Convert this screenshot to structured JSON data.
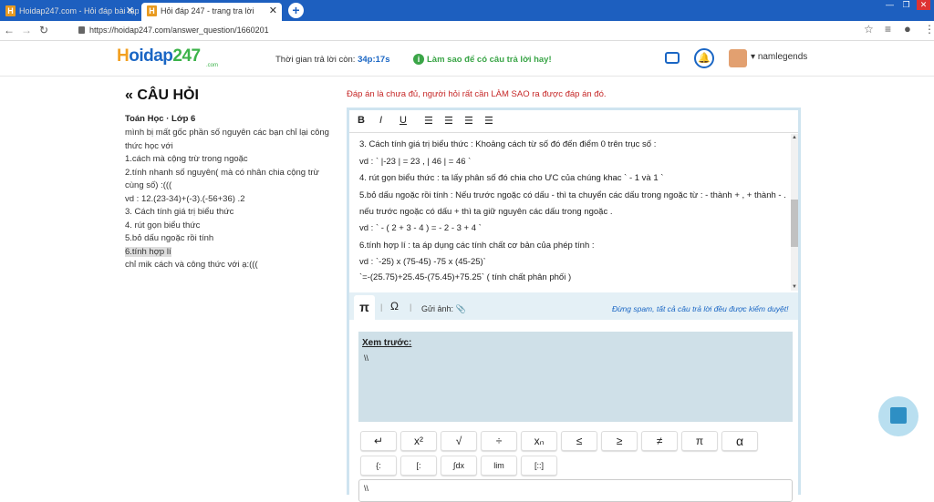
{
  "browser": {
    "tabs": [
      {
        "title": "Hoidap247.com - Hỏi đáp bài tập",
        "favicon": "H"
      },
      {
        "title": "Hỏi đáp 247 - trang tra lời",
        "favicon": "H"
      }
    ],
    "url": "https://hoidap247.com/answer_question/1660201",
    "new_tab": "+"
  },
  "header": {
    "logo": {
      "h": "H",
      "oi": "oidap",
      "num": "247",
      "sub": ".com"
    },
    "timer_label": "Thời gian trả lời còn:",
    "timer_value": "34p:17s",
    "howto": "Làm sao để có câu trả lời hay!",
    "username": "namlegends",
    "info_icon": "i"
  },
  "question": {
    "heading": "« CÂU HỎI",
    "meta": "Toán Học · Lớp 6",
    "lines": [
      "mình bị mất gốc phần số nguyên các bạn chỉ lại công thức học với",
      "1.cách mà cộng trừ trong ngoặc",
      "2.tính nhanh số nguyên( mà có nhân chia cộng trừ cùng số) :(((",
      "vd : 12.(23-34)+(-3).(-56+36) .2",
      "3. Cách tính giá trị biểu thức",
      "4. rút gọn biểu thức",
      "5.bỏ dấu ngoặc rồi tính",
      "6.tính hợp lí",
      "chỉ mik cách và công thức với ạ:((("
    ]
  },
  "editor": {
    "warning": "Đáp án là chưa đủ, người hỏi rất cần LÀM SAO ra được đáp án đó.",
    "toolbar": {
      "bold": "B",
      "italic": "I",
      "underline": "U"
    },
    "content_lines": [
      "3. Cách tính giá trị biểu thức : Khoảng cách từ số đó đến điểm 0 trên trục số :",
      "vd : ` |-23 | = 23 , | 46 | = 46 `",
      "4. rút gọn biểu thức : ta lấy phân số đó chia cho ƯC của chúng khac ` - 1 và 1 `",
      "5.bỏ dấu ngoặc rồi tính : Nếu trước ngoặc có dấu - thì ta chuyển các dấu trong ngoặc từ : - thành  + , + thành - .",
      "nếu trước ngoặc có dấu + thì ta giữ nguyên các dấu trong ngoặc .",
      "vd : ` - ( 2 + 3 - 4 )  = - 2 - 3 + 4 `",
      "6.tính hợp lí : ta áp dụng các tính chất cơ bản của phép tính :",
      "vd : `-25) x (75-45) -75 x (45-25)`",
      "`=-(25.75)+25.45-(75.45)+75.25`        ( tính chất phân phối )"
    ],
    "math_tabs": {
      "pi": "π",
      "omega": "Ω",
      "upload": "Gửi ảnh:"
    },
    "spam_note": "Đừng spam, tất cả câu trả lời đều được kiểm duyệt!",
    "preview_title": "Xem trước:",
    "preview_value": "\\\\",
    "input_value": "\\\\",
    "keys_row1": [
      "↵",
      "x²",
      "√",
      "÷",
      "xₙ",
      "≤",
      "≥",
      "≠",
      "π",
      "α"
    ],
    "keys_row2": [
      "{:",
      "[:",
      "∫dx",
      "lim",
      "[::]"
    ]
  }
}
